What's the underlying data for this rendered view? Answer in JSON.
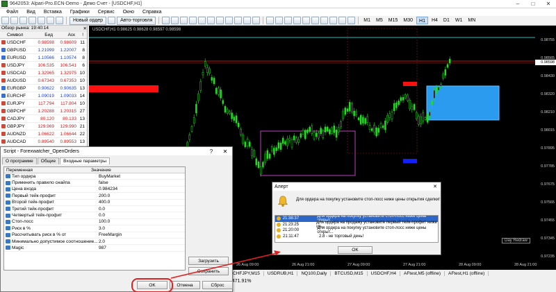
{
  "window": {
    "title": "9642053: Alpari-Pro.ECN-Demo - Демо Счет - [USDCHF,H1]"
  },
  "menu": [
    "Файл",
    "Вид",
    "Вставка",
    "Графики",
    "Сервис",
    "Окно",
    "Справка"
  ],
  "toolbar": {
    "new_order": "Новый ордер",
    "autotrading": "Авто-торговля",
    "timeframes": [
      "M1",
      "M5",
      "M15",
      "M30",
      "H1",
      "H4",
      "D1",
      "W1",
      "MN"
    ],
    "active_tf": "H1"
  },
  "market_watch": {
    "title": "Обзор рынка: 19:40:14",
    "headers": {
      "symbol": "Символ",
      "bid": "Бид",
      "ask": "Аск",
      "spread": "!"
    },
    "rows": [
      {
        "symbol": "USDCHF",
        "bid": "0.98598",
        "ask": "0.98609",
        "spread": "11",
        "dir": "dn"
      },
      {
        "symbol": "GBPUSD",
        "bid": "1.21999",
        "ask": "1.22007",
        "spread": "8",
        "dir": "up"
      },
      {
        "symbol": "EURUSD",
        "bid": "1.10566",
        "ask": "1.10574",
        "spread": "8",
        "dir": "up"
      },
      {
        "symbol": "USDJPY",
        "bid": "106.535",
        "ask": "106.541",
        "spread": "6",
        "dir": "dn"
      },
      {
        "symbol": "USDCAD",
        "bid": "1.32965",
        "ask": "1.32975",
        "spread": "10",
        "dir": "dn"
      },
      {
        "symbol": "AUDUSD",
        "bid": "0.67343",
        "ask": "0.67353",
        "spread": "10",
        "dir": "dn"
      },
      {
        "symbol": "EURGBP",
        "bid": "0.90622",
        "ask": "0.90635",
        "spread": "13",
        "dir": "up"
      },
      {
        "symbol": "EURCHF",
        "bid": "1.09019",
        "ask": "1.09033",
        "spread": "14",
        "dir": "up"
      },
      {
        "symbol": "EURJPY",
        "bid": "117.794",
        "ask": "117.804",
        "spread": "10",
        "dir": "dn"
      },
      {
        "symbol": "GBPCHF",
        "bid": "1.20288",
        "ask": "1.20315",
        "spread": "27",
        "dir": "dn"
      },
      {
        "symbol": "CADJPY",
        "bid": "80.120",
        "ask": "80.133",
        "spread": "13",
        "dir": "dn"
      },
      {
        "symbol": "GBPJPY",
        "bid": "129.969",
        "ask": "129.990",
        "spread": "21",
        "dir": "dn"
      },
      {
        "symbol": "AUDNZD",
        "bid": "1.06622",
        "ask": "1.06644",
        "spread": "22",
        "dir": "dn"
      },
      {
        "symbol": "AUDCAD",
        "bid": "0.89540",
        "ask": "0.89553",
        "spread": "13",
        "dir": "dn"
      }
    ]
  },
  "chart": {
    "label": "USDCHF,H1  0.98625 0.98628 0.98597 0.98598",
    "prices": [
      "0.98755",
      "0.98565",
      "0.98430",
      "0.98320",
      "0.98210",
      "0.98015",
      "0.97895",
      "0.97785",
      "0.97675",
      "0.97565",
      "0.97455",
      "0.97345",
      "0.97235"
    ],
    "current_price": "0.98598",
    "times": [
      "26 Aug 09:00",
      "26 Aug 21:00",
      "27 Aug 09:00",
      "27 Aug 21:00",
      "28 Aug 09:00",
      "28 Aug 21:00",
      "29 Aug 09:00"
    ],
    "redraw_label": "Day Redraw"
  },
  "chart_tabs": [
    "CHFJPY,M15",
    "USDRUB,H1",
    "NQ100,Daily",
    "BTCUSD,M15",
    "USDCHF,H4",
    "AFtest,M5 (offline)",
    "AFtest,H1 (offline)"
  ],
  "status": "6471.91%",
  "script_dialog": {
    "title": "Script - Forexwatcher_OpenOrders",
    "help": "?",
    "close": "✕",
    "tabs": [
      "О программе",
      "Общие",
      "Входные параметры"
    ],
    "headers": {
      "name": "Переменная",
      "value": "Значение"
    },
    "params": [
      {
        "name": "Тип ордера",
        "value": "BuyMarket"
      },
      {
        "name": "Применить правило снайпа",
        "value": "false"
      },
      {
        "name": "Цена входа",
        "value": "0.984234"
      },
      {
        "name": "Первый тейк-профит",
        "value": "200.0"
      },
      {
        "name": "Второй тейк-профит",
        "value": "400.0"
      },
      {
        "name": "Третий тейк-профит",
        "value": "0.0"
      },
      {
        "name": "Четвертый тейк-профит",
        "value": "0.0"
      },
      {
        "name": "Стоп-лосс",
        "value": "100.0"
      },
      {
        "name": "Риск в %",
        "value": "3.0"
      },
      {
        "name": "Рассчитывать риск в % от",
        "value": "FreeMargin"
      },
      {
        "name": "Минимально допустимое соотношение...",
        "value": "2.0"
      },
      {
        "name": "Magic",
        "value": "987"
      }
    ],
    "load": "Загрузить",
    "save": "Сохранить",
    "ok": "OK",
    "cancel": "Отмена",
    "reset": "Сброс"
  },
  "alert": {
    "title": "Алерт",
    "close": "✕",
    "message": "Для ордера на покупку установите стоп-лосс ниже цены открытия сделки!",
    "rows": [
      {
        "time": "21:38:37",
        "text": "Для ордера на покупку установите стоп-лосс ниже цены открыт..."
      },
      {
        "time": "21:23:25",
        "text": "Для ордера на продажу установите первый тейк-профит ниже це..."
      },
      {
        "time": "21:20:00",
        "text": "Для ордера на покупку установите стоп-лосс ниже цены открыт..."
      },
      {
        "time": "21:11:47",
        "text": "2.8 - не торговый день!"
      }
    ],
    "ok": "OK"
  }
}
